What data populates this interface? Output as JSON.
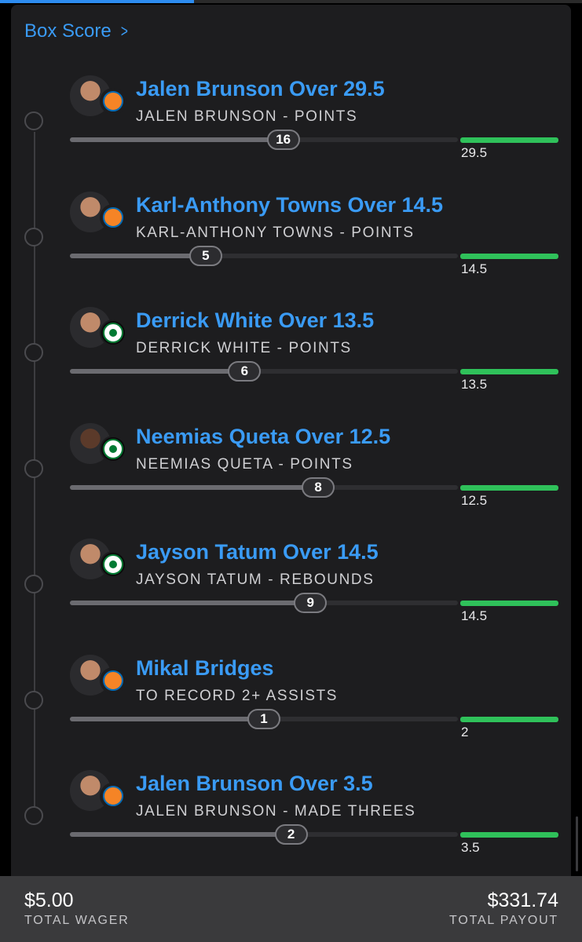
{
  "header": {
    "box_score_label": "Box Score",
    "chevron_icon": "chevron-right-icon",
    "accent": "#3a9bf5"
  },
  "legs": [
    {
      "title": "Jalen Brunson Over 29.5",
      "subtitle": "JALEN BRUNSON - POINTS",
      "current": "16",
      "target": "29.5",
      "progress": 0.55,
      "team": "nyk"
    },
    {
      "title": "Karl-Anthony Towns Over 14.5",
      "subtitle": "KARL-ANTHONY TOWNS - POINTS",
      "current": "5",
      "target": "14.5",
      "progress": 0.35,
      "team": "nyk"
    },
    {
      "title": "Derrick White Over 13.5",
      "subtitle": "DERRICK WHITE - POINTS",
      "current": "6",
      "target": "13.5",
      "progress": 0.45,
      "team": "bos"
    },
    {
      "title": "Neemias Queta Over 12.5",
      "subtitle": "NEEMIAS QUETA - POINTS",
      "current": "8",
      "target": "12.5",
      "progress": 0.64,
      "team": "bos"
    },
    {
      "title": "Jayson Tatum Over 14.5",
      "subtitle": "JAYSON TATUM - REBOUNDS",
      "current": "9",
      "target": "14.5",
      "progress": 0.62,
      "team": "bos"
    },
    {
      "title": "Mikal Bridges",
      "subtitle": "TO RECORD 2+ ASSISTS",
      "current": "1",
      "target": "2",
      "progress": 0.5,
      "team": "nyk"
    },
    {
      "title": "Jalen Brunson Over 3.5",
      "subtitle": "JALEN BRUNSON - MADE THREES",
      "current": "2",
      "target": "3.5",
      "progress": 0.57,
      "team": "nyk"
    }
  ],
  "footer": {
    "wager": "$5.00",
    "wager_label": "TOTAL WAGER",
    "payout": "$331.74",
    "payout_label": "TOTAL PAYOUT"
  },
  "colors": {
    "target_bar": "#2fc15a",
    "background": "#1d1d1f"
  }
}
